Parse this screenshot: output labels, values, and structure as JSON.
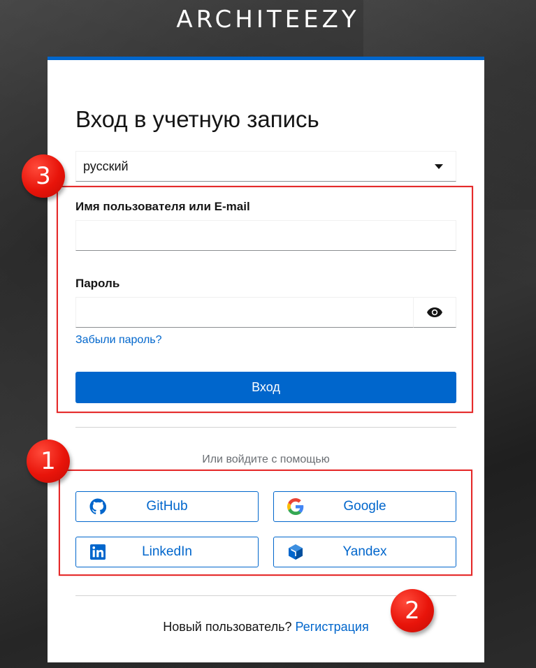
{
  "brand": {
    "name": "ARCHITEEZY"
  },
  "login": {
    "title": "Вход в учетную запись",
    "language_selected": "русский",
    "username_label": "Имя пользователя или E-mail",
    "username_value": "",
    "password_label": "Пароль",
    "password_value": "",
    "forgot_password": "Забыли пароль?",
    "submit_label": "Вход"
  },
  "social": {
    "or_text": "Или войдите с помощью",
    "providers": [
      {
        "label": "GitHub",
        "icon": "github-icon"
      },
      {
        "label": "Google",
        "icon": "google-icon"
      },
      {
        "label": "LinkedIn",
        "icon": "linkedin-icon"
      },
      {
        "label": "Yandex",
        "icon": "yandex-icon"
      }
    ]
  },
  "register": {
    "prompt": "Новый пользователь?",
    "link": "Регистрация"
  },
  "annotations": [
    {
      "number": "3"
    },
    {
      "number": "1"
    },
    {
      "number": "2"
    }
  ],
  "colors": {
    "accent": "#0066cc",
    "annotation": "#e52b2b",
    "badge": "#e8140a"
  }
}
